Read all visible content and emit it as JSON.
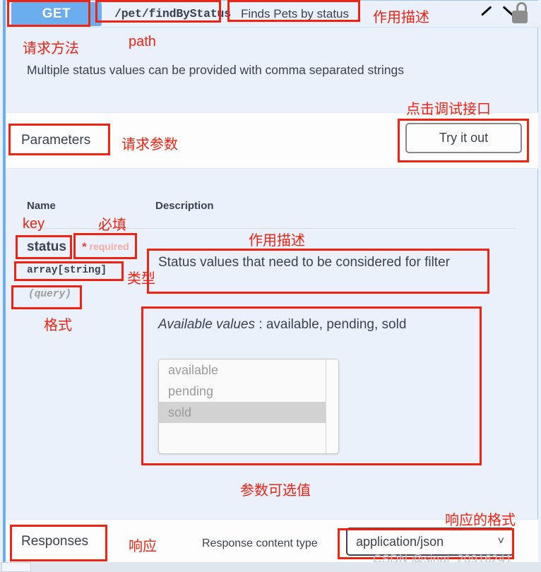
{
  "operation": {
    "method": "GET",
    "path": "/pet/findByStatus",
    "summary": "Finds Pets by status",
    "description": "Multiple status values can be provided with comma separated strings",
    "collapse_icon": "chevron-up-icon",
    "auth_icon": "unlocked-padlock-icon"
  },
  "parameters_section": {
    "title": "Parameters",
    "try_it_out_label": "Try it out",
    "columns": {
      "name": "Name",
      "description": "Description"
    },
    "rows": [
      {
        "name": "status",
        "required_star": "*",
        "required_label": "required",
        "type": "array[string]",
        "in": "(query)",
        "description": "Status values that need to be considered for filter",
        "available_values_label": "Available values",
        "available_values_separator": " : ",
        "available_values_text": "available, pending, sold",
        "options": [
          "available",
          "pending",
          "sold"
        ],
        "selected_option": "sold"
      }
    ]
  },
  "responses_section": {
    "title": "Responses",
    "content_type_label": "Response content type",
    "content_type_value": "application/json",
    "caret_icon": "chevron-down-icon"
  },
  "annotations": [
    {
      "text": "作用描述",
      "kind": "label"
    },
    {
      "text": "请求方法",
      "kind": "label"
    },
    {
      "text": "path",
      "kind": "label"
    },
    {
      "text": "点击调试接口",
      "kind": "label"
    },
    {
      "text": "请求参数",
      "kind": "label"
    },
    {
      "text": "key",
      "kind": "label"
    },
    {
      "text": "必填",
      "kind": "label"
    },
    {
      "text": "作用描述",
      "kind": "label"
    },
    {
      "text": "类型",
      "kind": "label"
    },
    {
      "text": "格式",
      "kind": "label"
    },
    {
      "text": "参数可选值",
      "kind": "label"
    },
    {
      "text": "响应",
      "kind": "label"
    },
    {
      "text": "响应的格式",
      "kind": "label"
    }
  ],
  "watermark": "CSDN @sinat_20916241",
  "colors": {
    "method_get": "#6aaef0",
    "panel_background": "#eaf1fb",
    "band_background": "#fdfdfd",
    "annotation_red": "#f02211",
    "required_pink": "#f8aaa4",
    "text": "#3b4151"
  }
}
